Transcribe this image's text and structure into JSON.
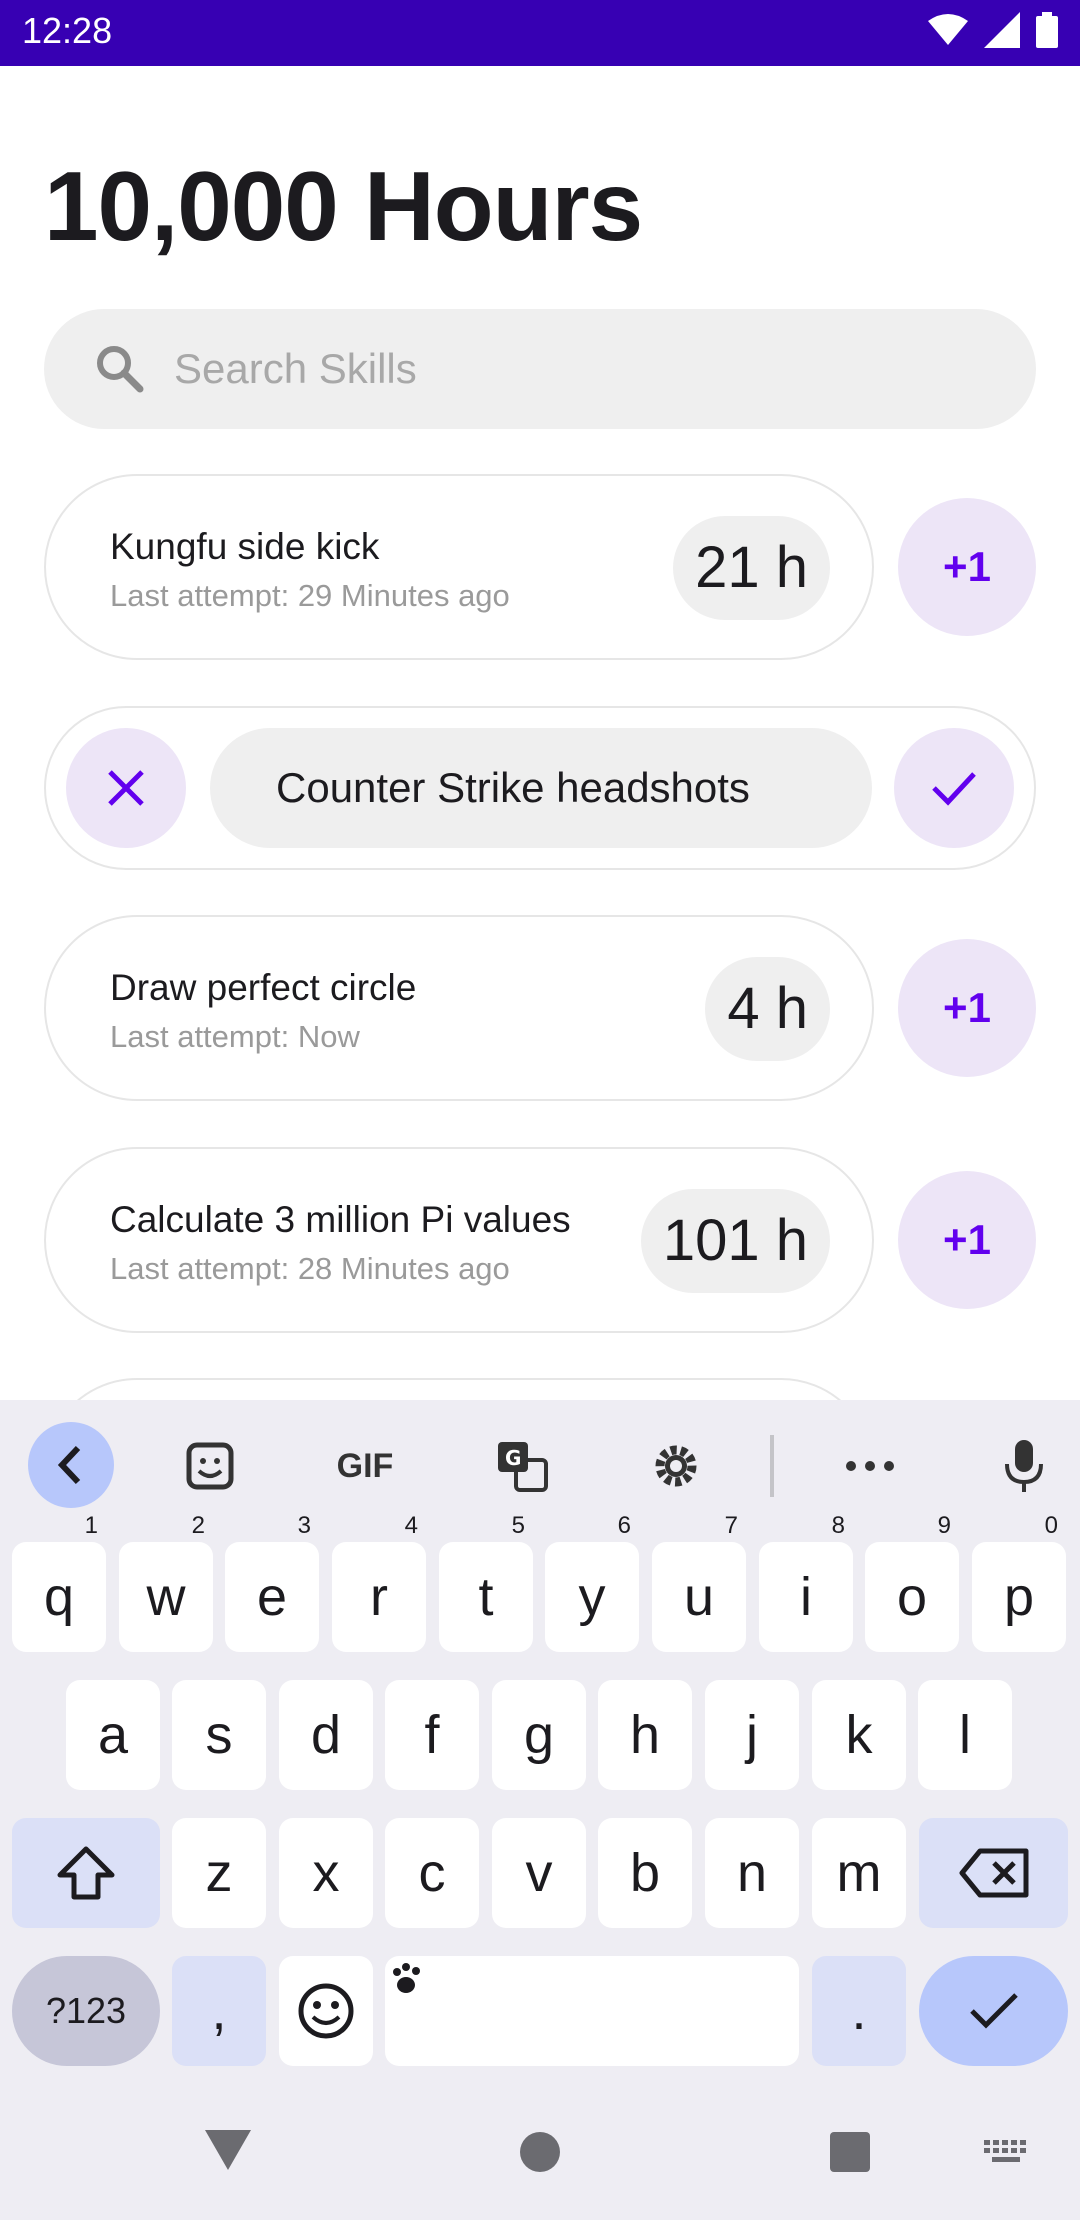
{
  "status": {
    "time": "12:28"
  },
  "app": {
    "title": "10,000 Hours",
    "search": {
      "placeholder": "Search Skills",
      "value": ""
    },
    "skills": [
      {
        "name": "Kungfu side kick",
        "last": "Last attempt: 29 Minutes ago",
        "hours": "21 h",
        "plus": "+1"
      },
      {
        "name": "Draw perfect circle",
        "last": "Last attempt: Now",
        "hours": "4 h",
        "plus": "+1"
      },
      {
        "name": "Calculate 3 million Pi values",
        "last": "Last attempt: 28 Minutes ago",
        "hours": "101 h",
        "plus": "+1"
      }
    ],
    "editing": {
      "value": "Counter Strike headshots"
    },
    "accent": "#6200ee"
  },
  "keyboard": {
    "toolbar": {
      "gif": "GIF"
    },
    "row1": [
      {
        "k": "q",
        "n": "1"
      },
      {
        "k": "w",
        "n": "2"
      },
      {
        "k": "e",
        "n": "3"
      },
      {
        "k": "r",
        "n": "4"
      },
      {
        "k": "t",
        "n": "5"
      },
      {
        "k": "y",
        "n": "6"
      },
      {
        "k": "u",
        "n": "7"
      },
      {
        "k": "i",
        "n": "8"
      },
      {
        "k": "o",
        "n": "9"
      },
      {
        "k": "p",
        "n": "0"
      }
    ],
    "row2": [
      "a",
      "s",
      "d",
      "f",
      "g",
      "h",
      "j",
      "k",
      "l"
    ],
    "row3": [
      "z",
      "x",
      "c",
      "v",
      "b",
      "n",
      "m"
    ],
    "symbols": "?123",
    "comma": ",",
    "period": "."
  }
}
